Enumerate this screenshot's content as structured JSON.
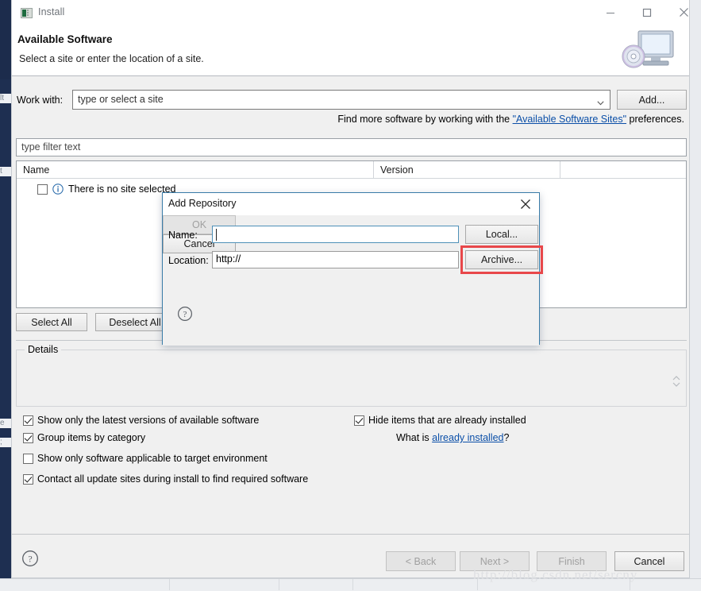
{
  "window": {
    "title": "Install",
    "icon": "install-app-icon",
    "controls": {
      "minimize": "—",
      "maximize": "☐",
      "close": "✕"
    }
  },
  "banner": {
    "title": "Available Software",
    "subtitle": "Select a site or enter the location of a site.",
    "art_icon": "monitor-cd-icon"
  },
  "work_with": {
    "label": "Work with:",
    "value": "type or select a site",
    "placeholder": "type or select a site",
    "add_button": "Add..."
  },
  "find_more": {
    "prefix": "Find more software by working with the ",
    "link": "\"Available Software Sites\"",
    "suffix": " preferences."
  },
  "filter": {
    "placeholder": "type filter text",
    "value": "type filter text"
  },
  "table": {
    "columns": [
      "Name",
      "Version",
      ""
    ],
    "rows": [
      {
        "checked": false,
        "icon": "info-icon",
        "name": "There is no site selected",
        "version": ""
      }
    ]
  },
  "select_buttons": {
    "select_all": "Select All",
    "deselect_all": "Deselect All"
  },
  "details": {
    "legend": "Details",
    "text": "",
    "spinner_icon": "scroll-spinner-icon"
  },
  "options": {
    "left": [
      {
        "label": "Show only the latest versions of available software",
        "checked": true
      },
      {
        "label": "Group items by category",
        "checked": true
      },
      {
        "label": "Show only software applicable to target environment",
        "checked": false
      },
      {
        "label": "Contact all update sites during install to find required software",
        "checked": true
      }
    ],
    "right": [
      {
        "label": "Hide items that are already installed",
        "checked": true
      }
    ],
    "what_is": {
      "prefix": "What is ",
      "link": "already installed",
      "suffix": "?"
    }
  },
  "footer": {
    "help_icon": "help-question-icon",
    "buttons": [
      {
        "label": "< Back",
        "enabled": false
      },
      {
        "label": "Next >",
        "enabled": false
      },
      {
        "label": "Finish",
        "enabled": false
      },
      {
        "label": "Cancel",
        "enabled": true
      }
    ]
  },
  "watermark": "http://blog.csdn.net/sercny",
  "modal": {
    "title": "Add Repository",
    "close_icon": "close-icon",
    "name": {
      "label": "Name:",
      "value": "",
      "placeholder": ""
    },
    "location": {
      "label": "Location:",
      "value": "http://",
      "placeholder": "http://"
    },
    "local_button": "Local...",
    "archive_button": "Archive...",
    "help_icon": "help-question-icon",
    "ok_button": "OK",
    "cancel_button": "Cancel",
    "highlight_color": "#e8474a"
  },
  "colors": {
    "accent_blue": "#0b4fa8",
    "dialog_border": "#3a7ca8",
    "window_chrome": "#f0f0f0",
    "desktop_dark": "#1c2c4c"
  }
}
